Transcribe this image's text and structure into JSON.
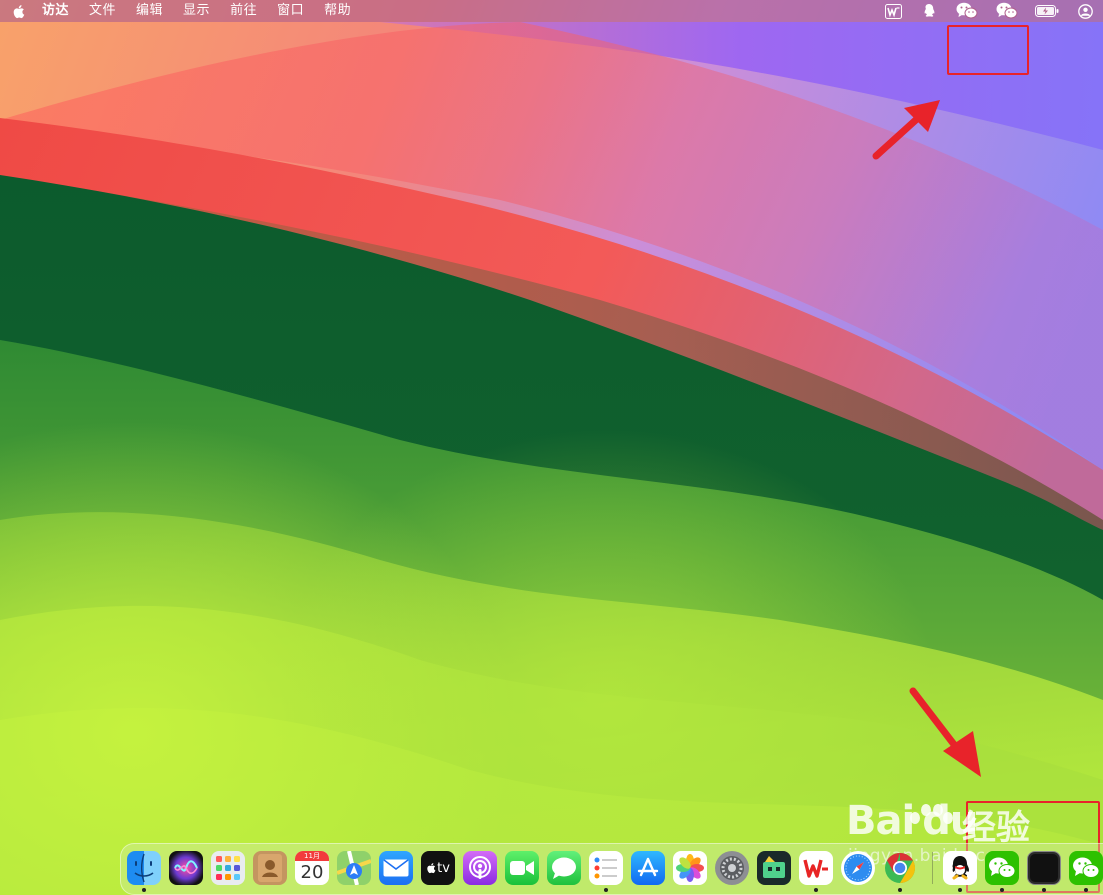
{
  "menubar": {
    "app_name": "访达",
    "items": [
      "文件",
      "编辑",
      "显示",
      "前往",
      "窗口",
      "帮助"
    ]
  },
  "tray": [
    {
      "name": "wps-office-icon"
    },
    {
      "name": "qq-tray-icon"
    },
    {
      "name": "wechat-tray-icon-1"
    },
    {
      "name": "wechat-tray-icon-2"
    },
    {
      "name": "battery-icon"
    },
    {
      "name": "user-account-icon"
    }
  ],
  "dock": {
    "calendar_month": "11月",
    "calendar_day": "20",
    "tv_label": "tv",
    "apps": [
      "finder",
      "siri",
      "launchpad",
      "contacts",
      "calendar",
      "maps",
      "mail",
      "apple-tv",
      "podcasts",
      "facetime",
      "messages",
      "reminders",
      "app-store",
      "photos",
      "system-settings",
      "nova-app",
      "wps-office",
      "safari",
      "chrome",
      "qq",
      "wechat",
      "terminal",
      "wechat-2"
    ]
  },
  "watermark": {
    "brand": "Bai",
    "brand2": "du",
    "product": "经验",
    "url": "jingyan.baidu.com"
  },
  "colors": {
    "annotation": "#e8232a",
    "menubar": "#b05f8c",
    "wechat": "#2dc100"
  }
}
